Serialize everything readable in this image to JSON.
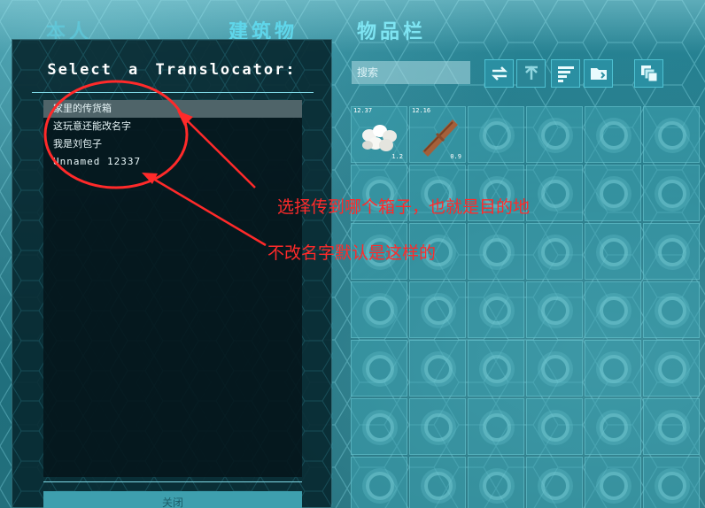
{
  "tabs": [
    {
      "label": "本人"
    },
    {
      "label": "建筑物"
    },
    {
      "label": "物品栏"
    }
  ],
  "dialog": {
    "title": "Select  a  Translocator:",
    "items": [
      {
        "label": "家里的传货箱",
        "selected": true
      },
      {
        "label": "这玩意还能改名字",
        "selected": false
      },
      {
        "label": "我是刘包子",
        "selected": false
      },
      {
        "label": "Unnamed  12337",
        "selected": false
      }
    ],
    "close_label": "关闭"
  },
  "inventory": {
    "search_placeholder": "搜索",
    "tools": [
      {
        "icon": "transfer-arrows-icon"
      },
      {
        "icon": "transfer-all-icon"
      },
      {
        "icon": "sort-icon"
      },
      {
        "icon": "folder-icon"
      },
      {
        "icon": "stack-icon"
      }
    ],
    "slots": [
      {
        "item": "eggs",
        "top_left": "12.37",
        "bottom_right": "1.2"
      },
      {
        "item": "wood-log",
        "top_left": "12.16",
        "bottom_right": "0.9"
      }
    ]
  },
  "annotations": {
    "note1": "选择传到哪个箱子，也就是目的地",
    "note2": "不改名字默认是这样的",
    "color": "#ff2a2a"
  }
}
